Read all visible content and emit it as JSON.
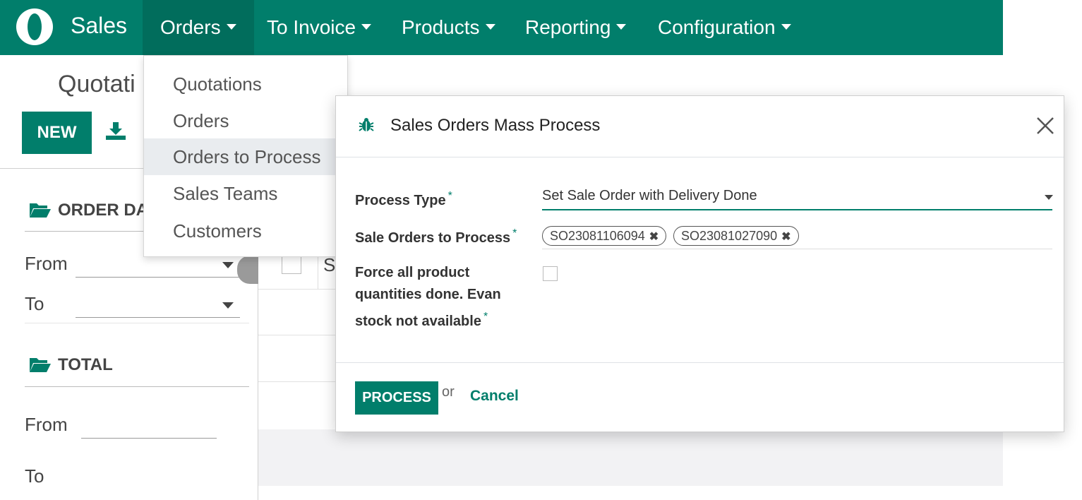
{
  "navbar": {
    "app_name": "Sales",
    "menus": [
      "Orders",
      "To Invoice",
      "Products",
      "Reporting",
      "Configuration"
    ],
    "active_menu": "Orders"
  },
  "page": {
    "title": "Quotati",
    "new_button": "NEW"
  },
  "sidebar": {
    "sections": [
      {
        "title": "ORDER DA",
        "filters": [
          "From",
          "To"
        ]
      },
      {
        "title": "TOTAL",
        "filters": [
          "From",
          "To"
        ]
      }
    ]
  },
  "list": {
    "header_fragment": "S"
  },
  "dropdown": {
    "items": [
      "Quotations",
      "Orders",
      "Orders to Process",
      "Sales Teams",
      "Customers"
    ],
    "highlighted": "Orders to Process"
  },
  "modal": {
    "title": "Sales Orders Mass Process",
    "fields": {
      "process_type_label": "Process Type",
      "process_type_value": "Set Sale Order with Delivery Done",
      "orders_label": "Sale Orders to Process",
      "orders": [
        "SO23081106094",
        "SO23081027090"
      ],
      "force_label_line1": "Force all product",
      "force_label_line2": "quantities done. Evan",
      "force_label_line3": "stock not available",
      "required_mark": "*"
    },
    "process_button": "PROCESS",
    "or_text": "or",
    "cancel_link": "Cancel"
  },
  "colors": {
    "brand": "#017e6b",
    "brand_dark": "#016d5c"
  }
}
